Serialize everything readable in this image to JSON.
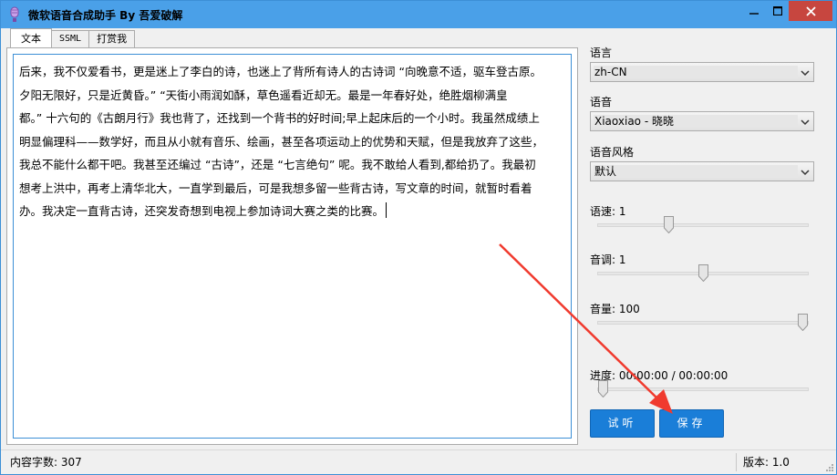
{
  "window": {
    "title": "微软语音合成助手 By 吾爱破解",
    "titlebar_color": "#4aa0e8",
    "close_color": "#c7463f"
  },
  "tabs": [
    {
      "label": "文本",
      "active": true
    },
    {
      "label": "SSML",
      "active": false
    },
    {
      "label": "打赏我",
      "active": false
    }
  ],
  "editor": {
    "text": "后来，我不仅爱看书，更是迷上了李白的诗，也迷上了背所有诗人的古诗词 “向晚意不适，驱车登古原。夕阳无限好，只是近黄昏。” “天街小雨润如酥，草色遥看近却无。最是一年春好处，绝胜烟柳满皇都。” 十六句的《古朗月行》我也背了，还找到一个背书的好时间;早上起床后的一个小时。我虽然成绩上明显偏理科——数学好，而且从小就有音乐、绘画，甚至各项运动上的优势和天赋，但是我放弃了这些，我总不能什么都干吧。我甚至还编过 “古诗”，还是 “七言绝句” 呢。我不敢给人看到,都给扔了。我最初想考上洪中，再考上清华北大，一直学到最后，可是我想多留一些背古诗，写文章的时间，就暂时看着办。我决定一直背古诗，还突发奇想到电视上参加诗词大赛之类的比赛。",
    "lines": [
      "后来，我不仅爱看书，更是迷上了李白的诗，也迷上了背所有诗人的古诗词 “向晚意不适，驱车登古原。",
      "夕阳无限好，只是近黄昏。” “天街小雨润如酥，草色遥看近却无。最是一年春好处，绝胜烟柳满皇",
      "都。” 十六句的《古朗月行》我也背了，还找到一个背书的好时间;早上起床后的一个小时。我虽然成绩上",
      "明显偏理科——数学好，而且从小就有音乐、绘画，甚至各项运动上的优势和天赋，但是我放弃了这些，",
      "我总不能什么都干吧。我甚至还编过 “古诗”，还是 “七言绝句” 呢。我不敢给人看到,都给扔了。我最初",
      "想考上洪中，再考上清华北大，一直学到最后，可是我想多留一些背古诗，写文章的时间，就暂时看着",
      "办。我决定一直背古诗，还突发奇想到电视上参加诗词大赛之类的比赛。"
    ],
    "border_color": "#3c8fd6"
  },
  "settings": {
    "language_label": "语言",
    "language_value": "zh-CN",
    "voice_label": "语音",
    "voice_value": "Xiaoxiao - 晓晓",
    "style_label": "语音风格",
    "style_value": "默认",
    "rate_label": "语速: 1",
    "rate_level": 0.33,
    "pitch_label": "音调: 1",
    "pitch_level": 0.5,
    "volume_label": "音量: 100",
    "volume_level": 1.0,
    "progress_label": "进度: 00:00:00 / 00:00:00",
    "progress_level": 0.0
  },
  "buttons": {
    "preview_label": "试听",
    "save_label": "保存",
    "color": "#1a7ed8"
  },
  "status": {
    "char_count": "内容字数: 307",
    "version": "版本: 1.0"
  },
  "annotation": {
    "arrow_color": "#f03a2e"
  }
}
